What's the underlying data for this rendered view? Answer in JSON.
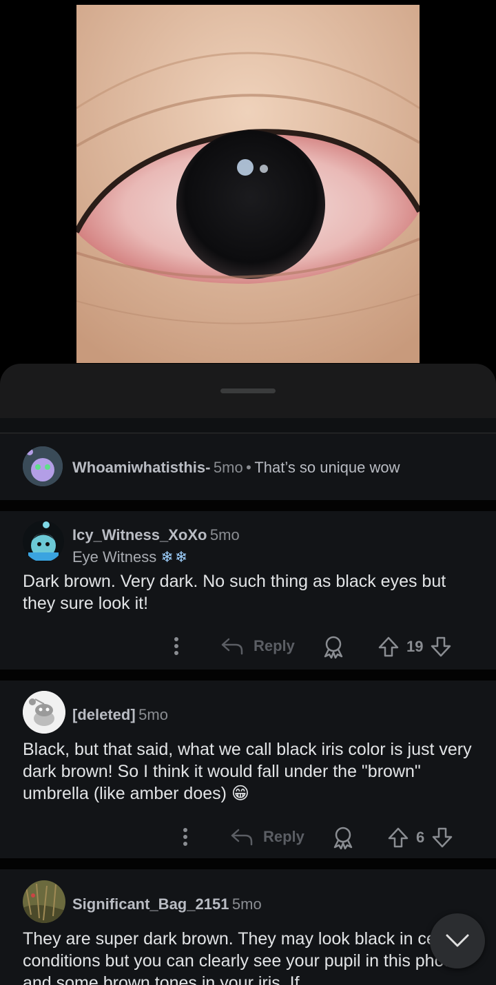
{
  "comments": [
    {
      "username": "Whoamiwhatisthis-",
      "age": "5mo",
      "separator": "•",
      "text": "That’s so unique wow"
    },
    {
      "username": "Icy_Witness_XoXo",
      "age": "5mo",
      "flair": "Eye Witness",
      "flair_emoji": "❄❄",
      "body": "Dark brown. Very dark. No such thing as black eyes but they sure look it!",
      "reply_label": "Reply",
      "score": "19"
    },
    {
      "username": "[deleted]",
      "age": "5mo",
      "body": "Black, but that said, what we call black iris color is just very dark brown! So I think it would fall under the \"brown\" umbrella (like amber does)",
      "emoji": "😁",
      "reply_label": "Reply",
      "score": "6"
    },
    {
      "username": "Significant_Bag_2151",
      "age": "5mo",
      "body": "They are super dark brown. They may look black in certain conditions but you can clearly see your pupil in this photo and some brown tones in your iris. If"
    }
  ],
  "icons": {
    "more": "more-vertical-icon",
    "reply": "reply-arrow-icon",
    "award": "award-icon",
    "upvote": "upvote-arrow-icon",
    "downvote": "downvote-arrow-icon",
    "scroll": "chevron-down-icon"
  },
  "colors": {
    "sheet": "#1a1a1b",
    "card": "#121417",
    "muted": "#5b5e64"
  }
}
